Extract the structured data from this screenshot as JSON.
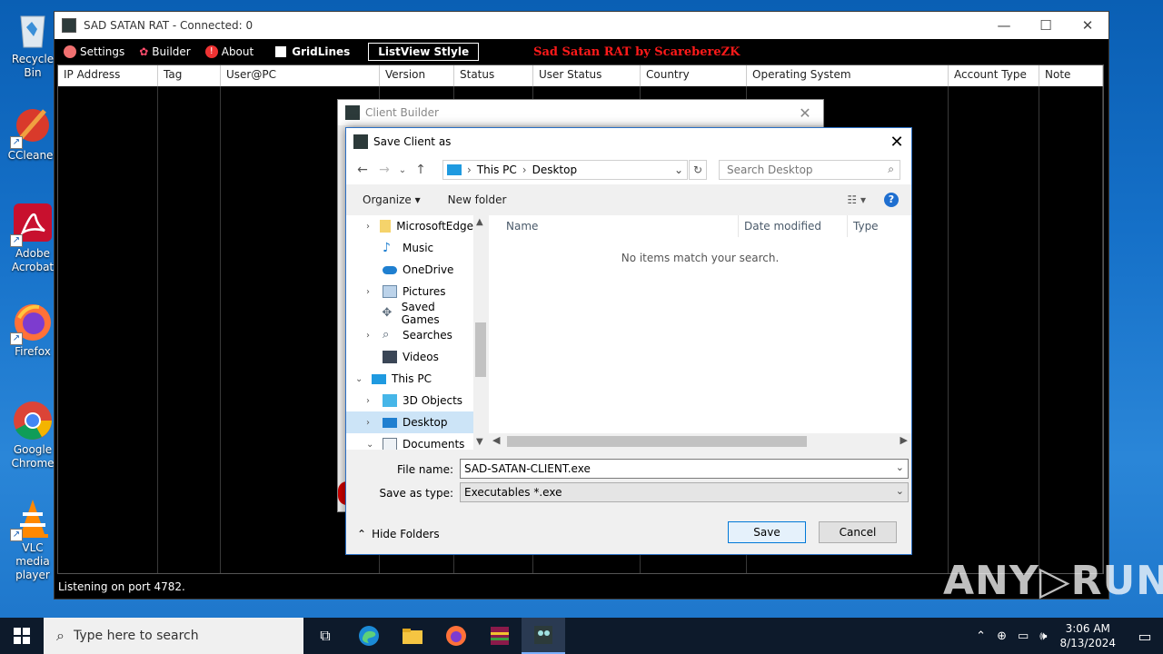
{
  "desktop": {
    "icons": [
      {
        "label": "Recycle Bin"
      },
      {
        "label": "CCleaner"
      },
      {
        "label": "Adobe Acrobat"
      },
      {
        "label": "Firefox"
      },
      {
        "label": "Google Chrome"
      },
      {
        "label": "VLC media player"
      }
    ]
  },
  "rat": {
    "title": "SAD SATAN RAT - Connected: 0",
    "menu": {
      "settings": "Settings",
      "builder": "Builder",
      "about": "About",
      "gridlines": "GridLines",
      "listview_style": "ListView Stlyle",
      "brand": "Sad Satan RAT by ScarebereZK"
    },
    "columns": [
      "IP Address",
      "Tag",
      "User@PC",
      "Version",
      "Status",
      "User Status",
      "Country",
      "Operating System",
      "Account Type",
      "Note"
    ],
    "status": "Listening on port 4782."
  },
  "builder": {
    "title": "Client Builder"
  },
  "save_dialog": {
    "title": "Save Client as",
    "breadcrumb": [
      "This PC",
      "Desktop"
    ],
    "search_placeholder": "Search Desktop",
    "organize": "Organize",
    "new_folder": "New folder",
    "tree": [
      {
        "label": "MicrosoftEdge",
        "expandable": true,
        "icon": "folder-icon"
      },
      {
        "label": "Music",
        "expandable": false,
        "icon": "music-icon"
      },
      {
        "label": "OneDrive",
        "expandable": false,
        "icon": "cloud-icon"
      },
      {
        "label": "Pictures",
        "expandable": true,
        "icon": "pictures-icon"
      },
      {
        "label": "Saved Games",
        "expandable": false,
        "icon": "games-icon"
      },
      {
        "label": "Searches",
        "expandable": true,
        "icon": "search-folder-icon"
      },
      {
        "label": "Videos",
        "expandable": false,
        "icon": "videos-icon"
      },
      {
        "label": "This PC",
        "expandable": true,
        "icon": "pc-icon"
      },
      {
        "label": "3D Objects",
        "expandable": true,
        "icon": "cube-icon"
      },
      {
        "label": "Desktop",
        "expandable": true,
        "icon": "desktop-icon",
        "selected": true
      },
      {
        "label": "Documents",
        "expandable": true,
        "icon": "documents-icon"
      }
    ],
    "list_columns": [
      "Name",
      "Date modified",
      "Type"
    ],
    "empty_message": "No items match your search.",
    "file_name_label": "File name:",
    "file_name": "SAD-SATAN-CLIENT.exe",
    "save_type_label": "Save as type:",
    "save_type": "Executables *.exe",
    "hide_folders": "Hide Folders",
    "save": "Save",
    "cancel": "Cancel"
  },
  "watermark": "ANY▷RUN",
  "taskbar": {
    "search_placeholder": "Type here to search",
    "time": "3:06 AM",
    "date": "8/13/2024"
  }
}
